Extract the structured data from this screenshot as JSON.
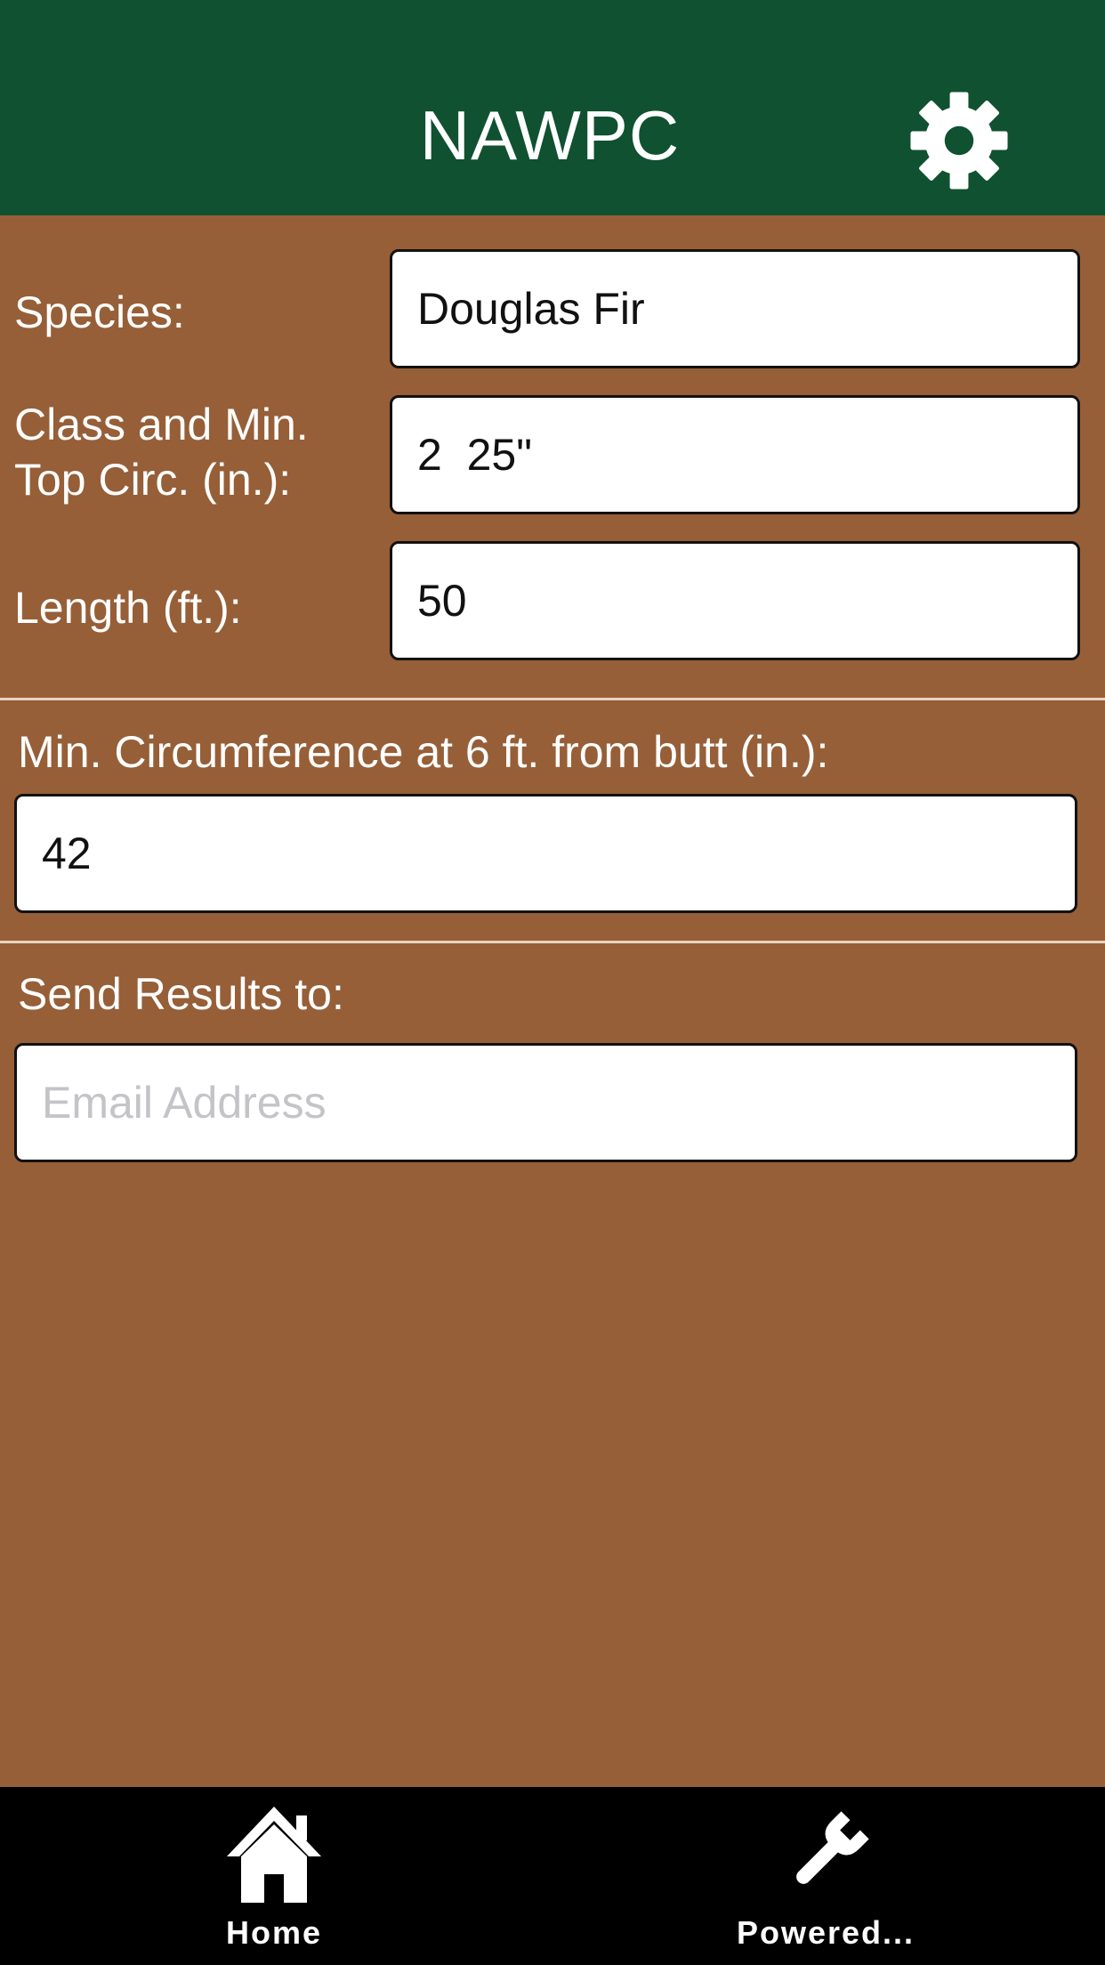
{
  "header": {
    "title": "NAWPC",
    "settings_icon": "gear-icon"
  },
  "form": {
    "species": {
      "label": "Species:",
      "value": "Douglas Fir"
    },
    "class": {
      "label_line1": "Class and Min.",
      "label_line2": "Top Circ. (in.):",
      "value": "2  25\""
    },
    "length": {
      "label": "Length (ft.):",
      "value": "50"
    }
  },
  "result": {
    "label": "Min. Circumference at 6 ft. from butt (in.):",
    "value": "42"
  },
  "email": {
    "label": "Send Results to:",
    "placeholder": "Email Address",
    "value": ""
  },
  "tabs": [
    {
      "label": "Home",
      "icon": "home-icon"
    },
    {
      "label": "Powered...",
      "icon": "wrench-icon"
    }
  ],
  "colors": {
    "header_bg": "#0f5130",
    "main_bg": "#965f38",
    "tabbar_bg": "#000000"
  }
}
